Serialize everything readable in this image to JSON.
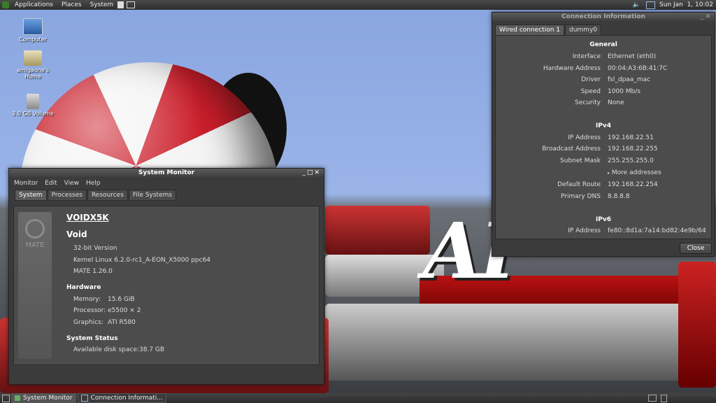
{
  "top_panel": {
    "menus": [
      "Applications",
      "Places",
      "System"
    ],
    "clock": "Sun Jan  1, 10:02"
  },
  "desktop_icons": [
    {
      "label": "Computer"
    },
    {
      "label": "amigaone's Home"
    },
    {
      "label": "3.0 GB Volume"
    }
  ],
  "system_monitor": {
    "title": "System Monitor",
    "menu": [
      "Monitor",
      "Edit",
      "View",
      "Help"
    ],
    "tabs": [
      "System",
      "Processes",
      "Resources",
      "File Systems"
    ],
    "logo_text": "MATE",
    "hostname": "VOIDX5K",
    "distro": "Void",
    "version_lines": [
      "32-bit Version",
      "Kernel Linux 6.2.0-rc1_A-EON_X5000 ppc64",
      "MATE 1.26.0"
    ],
    "hardware_heading": "Hardware",
    "hardware": [
      {
        "label": "Memory:",
        "value": "15.6 GiB"
      },
      {
        "label": "Processor:",
        "value": "e5500 × 2"
      },
      {
        "label": "Graphics:",
        "value": "ATI R580"
      }
    ],
    "status_heading": "System Status",
    "disk": {
      "label": "Available disk space:",
      "value": "38.7 GB"
    }
  },
  "connection_info": {
    "title": "Connection Information",
    "tabs": [
      "Wired connection 1",
      "dummy0"
    ],
    "general_heading": "General",
    "general": [
      {
        "label": "Interface",
        "value": "Ethernet (eth0)"
      },
      {
        "label": "Hardware Address",
        "value": "00:04:A3:6B:41:7C"
      },
      {
        "label": "Driver",
        "value": "fsl_dpaa_mac"
      },
      {
        "label": "Speed",
        "value": "1000 Mb/s"
      },
      {
        "label": "Security",
        "value": "None"
      }
    ],
    "ipv4_heading": "IPv4",
    "ipv4": [
      {
        "label": "IP Address",
        "value": "192.168.22.51"
      },
      {
        "label": "Broadcast Address",
        "value": "192.168.22.255"
      },
      {
        "label": "Subnet Mask",
        "value": "255.255.255.0"
      }
    ],
    "more_addresses": "More addresses",
    "ipv4_extra": [
      {
        "label": "Default Route",
        "value": "192.168.22.254"
      },
      {
        "label": "Primary DNS",
        "value": "8.8.8.8"
      }
    ],
    "ipv6_heading": "IPv6",
    "ipv6": [
      {
        "label": "IP Address",
        "value": "fe80::8d1a:7a14:bd82:4e9b/64"
      }
    ],
    "close_label": "Close"
  },
  "taskbar": {
    "items": [
      "System Monitor",
      "Connection Informati..."
    ]
  },
  "colors": {
    "panel_bg": "#3b3b3b",
    "accent_red": "#cc1f2b"
  }
}
